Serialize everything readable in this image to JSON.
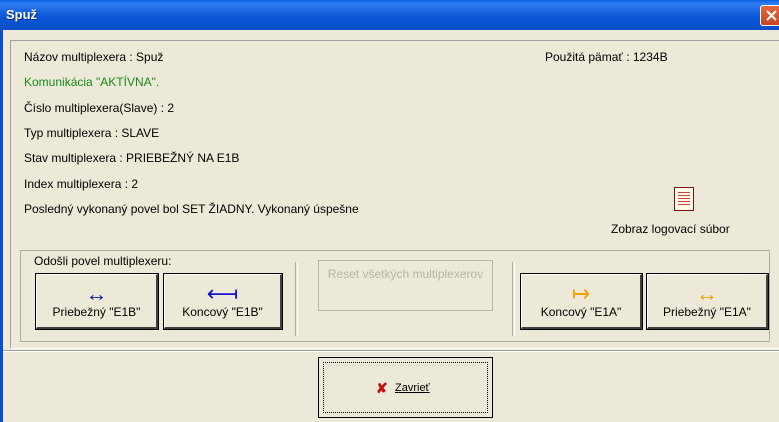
{
  "window": {
    "title": "Spuž"
  },
  "info": {
    "name_line": "Názov multiplexera : Spuž",
    "memory_line": "Použitá pämať : 1234B",
    "comm_line": "Komunikácia  \"AKTÍVNA\".",
    "slave_line": "Číslo multiplexera(Slave) :  2",
    "type_line": "Typ multiplexera : SLAVE",
    "state_line": "Stav multiplexera : PRIEBEŽNÝ NA E1B",
    "index_line": "Index multiplexera :  2",
    "last_cmd_line": "Posledný vykonaný povel bol SET ŽIADNY. Vykonaný úspešne",
    "log_label": "Zobraz logovací súbor"
  },
  "commands": {
    "group_label": "Odošli povel multiplexeru:",
    "btn1": {
      "label": "Priebežný \"E1B\"",
      "arrow": "↔",
      "arrow_color": "#1414c8"
    },
    "btn2": {
      "label": "Koncový \"E1B\"",
      "arrow": "⟻",
      "arrow_color": "#1414c8"
    },
    "reset_label": "Reset všetkých multiplexerov",
    "btn3": {
      "label": "Koncový \"E1A\"",
      "arrow": "↦",
      "arrow_color": "#f2a200"
    },
    "btn4": {
      "label": "Priebežný \"E1A\"",
      "arrow": "↔",
      "arrow_color": "#f2a200"
    }
  },
  "footer": {
    "close_label": "Zavrieť"
  }
}
